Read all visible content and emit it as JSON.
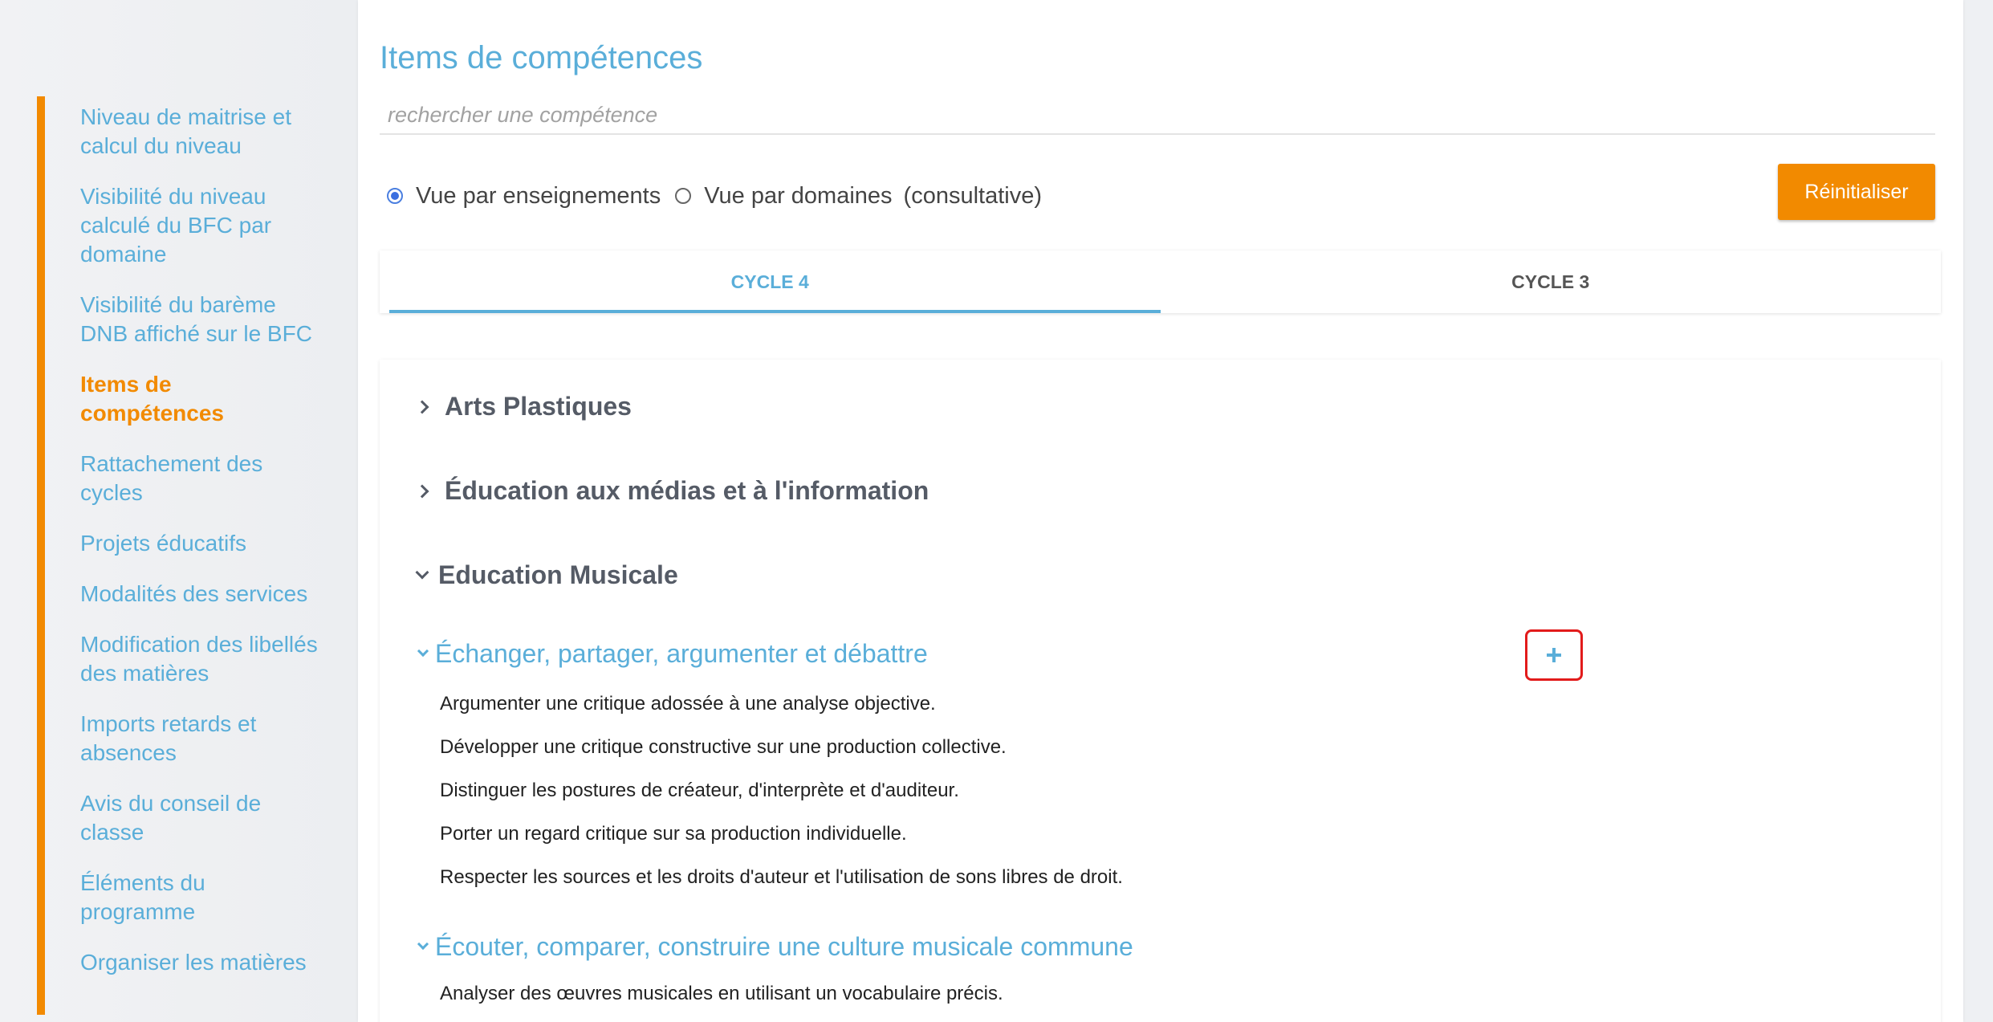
{
  "sidebar": {
    "items": [
      {
        "label": "Niveau de maitrise et calcul du niveau",
        "active": false
      },
      {
        "label": "Visibilité du niveau calculé du BFC par domaine",
        "active": false
      },
      {
        "label": "Visibilité du barème DNB affiché sur le BFC",
        "active": false
      },
      {
        "label": "Items de compétences",
        "active": true
      },
      {
        "label": "Rattachement des cycles",
        "active": false
      },
      {
        "label": "Projets éducatifs",
        "active": false
      },
      {
        "label": "Modalités des services",
        "active": false
      },
      {
        "label": "Modification des libellés des matières",
        "active": false
      },
      {
        "label": "Imports retards et absences",
        "active": false
      },
      {
        "label": "Avis du conseil de classe",
        "active": false
      },
      {
        "label": "Éléments du programme",
        "active": false
      },
      {
        "label": "Organiser les matières",
        "active": false
      }
    ]
  },
  "main": {
    "title": "Items de compétences",
    "search_placeholder": "rechercher une compétence",
    "view_options": {
      "by_teaching": "Vue par enseignements",
      "by_domain": "Vue par domaines",
      "by_domain_note": "(consultative)",
      "selected": "by_teaching"
    },
    "reset_label": "Réinitialiser",
    "tabs": [
      {
        "label": "CYCLE 4",
        "active": true
      },
      {
        "label": "CYCLE 3",
        "active": false
      }
    ],
    "sections": [
      {
        "label": "Arts Plastiques",
        "expanded": false
      },
      {
        "label": "Éducation aux médias et à l'information",
        "expanded": false
      },
      {
        "label": "Education Musicale",
        "expanded": true
      }
    ],
    "subsections": [
      {
        "label": "Échanger, partager, argumenter et débattre",
        "items": [
          "Argumenter une critique adossée à une analyse objective.",
          "Développer une critique constructive sur une production collective.",
          "Distinguer les postures de créateur, d'interprète et d'auditeur.",
          "Porter un regard critique sur sa production individuelle.",
          "Respecter les sources et les droits d'auteur et l'utilisation de sons libres de droit."
        ]
      },
      {
        "label": "Écouter, comparer, construire une culture musicale commune",
        "items": [
          "Analyser des œuvres musicales en utilisant un vocabulaire précis."
        ]
      }
    ],
    "highlight_color": "#e21b1b",
    "accent_color": "#5aaed9",
    "brand_orange": "#f28a00"
  }
}
